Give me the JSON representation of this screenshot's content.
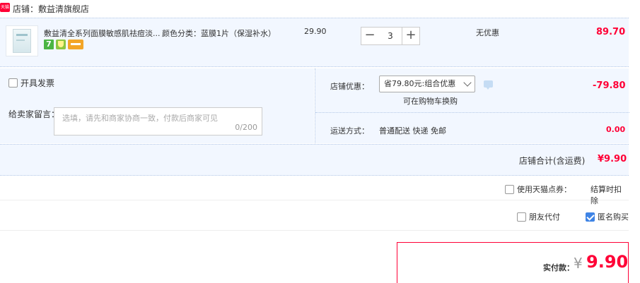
{
  "shop": {
    "badge": "天猫",
    "name": "店铺：敷益清旗舰店"
  },
  "item": {
    "title": "敷益清全系列面膜敏感肌祛痘淡...",
    "spec": "颜色分类：蓝膜1片（保湿补水）",
    "unit_price": "29.90",
    "quantity": "3",
    "minus": "−",
    "plus": "+",
    "discount": "无优惠",
    "subtotal": "89.70",
    "tag_seven": "7"
  },
  "options": {
    "invoice_label": "开具发票",
    "message_label": "给卖家留言：",
    "message_placeholder": "选填，请先和商家协商一致，付款后商家可见",
    "message_count": "0/200",
    "coupon_label": "店铺优惠：",
    "coupon_selected": "省79.80元:组合优惠",
    "coupon_note": "可在购物车换购",
    "coupon_amount": "-79.80",
    "shipping_label": "运送方式：",
    "shipping_value": "普通配送 快递 免邮",
    "shipping_fee": "0.00"
  },
  "summary": {
    "total_label": "店铺合计(含运费)",
    "total_amount": "¥9.90",
    "points_label": "使用天猫点券：",
    "points_note": "结算时扣除",
    "friend_pay_label": "朋友代付",
    "anonymous_label": "匿名购买",
    "anonymous_checked": true,
    "pay_label": "实付款：",
    "pay_currency": "¥",
    "pay_amount": "9.90"
  },
  "colors": {
    "accent_red": "#ff0036",
    "panel_blue": "#f2f7ff",
    "checkbox_blue": "#3f84e5"
  }
}
